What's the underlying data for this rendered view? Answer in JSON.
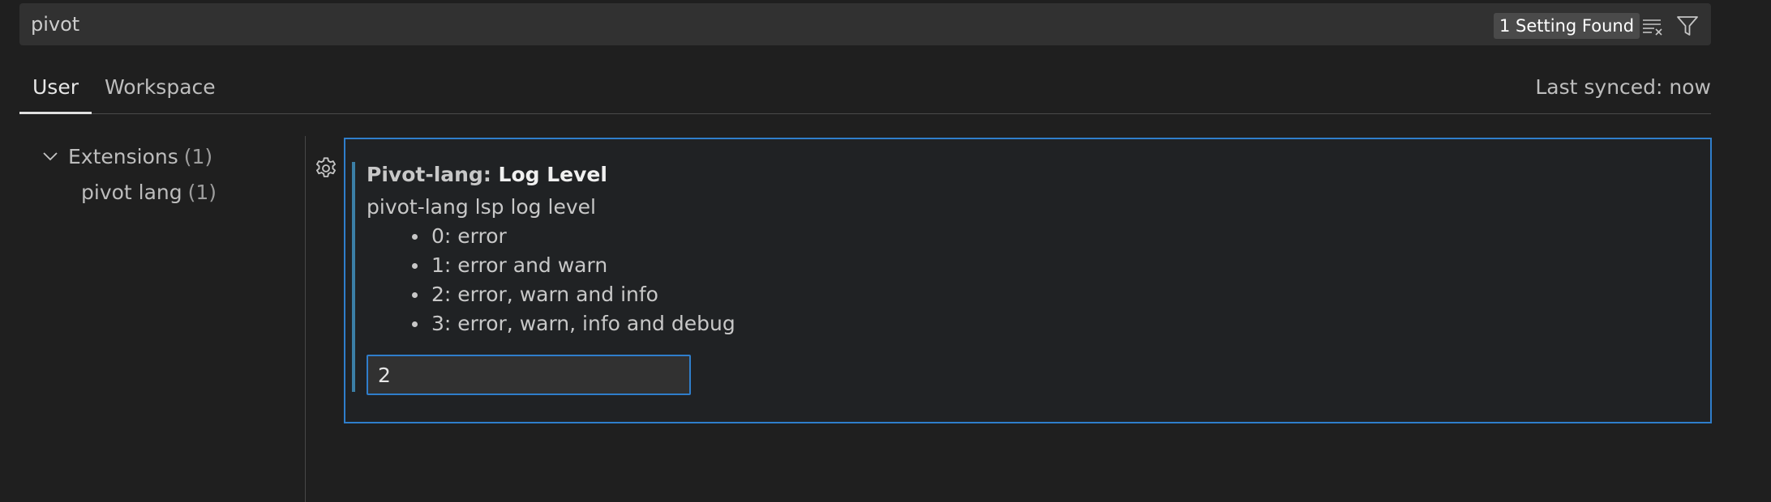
{
  "search": {
    "value": "pivot",
    "result_count": "1 Setting Found",
    "clear_icon": "clear-filter-icon",
    "filter_icon": "filter-icon"
  },
  "tabs": [
    {
      "label": "User",
      "active": true
    },
    {
      "label": "Workspace",
      "active": false
    }
  ],
  "sync_status": "Last synced: now",
  "toc": {
    "extensions": {
      "label": "Extensions",
      "count": "(1)",
      "icon": "chevron-down-icon"
    },
    "pivot_lang": {
      "label": "pivot lang",
      "count": "(1)"
    }
  },
  "setting": {
    "category": "Pivot-lang: ",
    "key": "Log Level",
    "description": "pivot-lang lsp log level",
    "options": [
      "0: error",
      "1: error and warn",
      "2: error, warn and info",
      "3: error, warn, info and debug"
    ],
    "value": "2",
    "gear_icon": "gear-icon"
  },
  "colors": {
    "background": "#1f1f1f",
    "focus_border": "#2f7ecb",
    "modified_indicator": "#3b7fa6"
  }
}
